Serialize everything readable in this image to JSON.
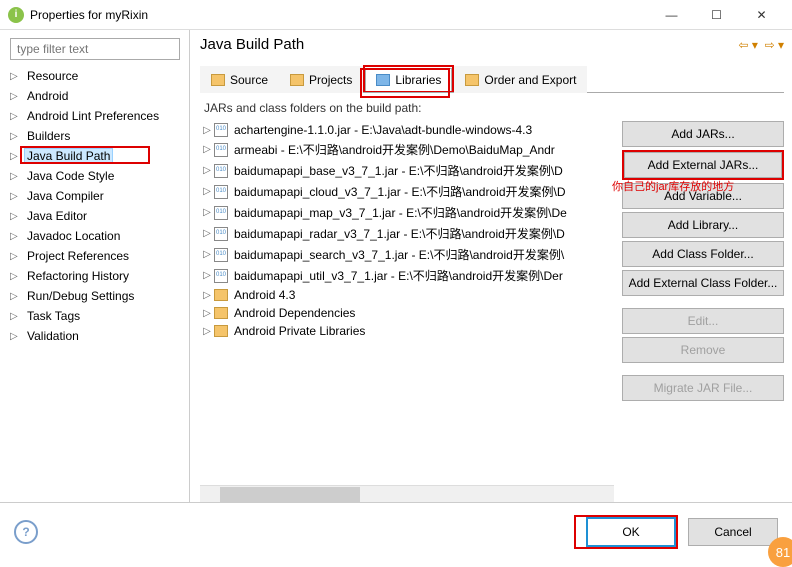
{
  "title": "Properties for myRixin",
  "filterPlaceholder": "type filter text",
  "tree": [
    "Resource",
    "Android",
    "Android Lint Preferences",
    "Builders",
    "Java Build Path",
    "Java Code Style",
    "Java Compiler",
    "Java Editor",
    "Javadoc Location",
    "Project References",
    "Refactoring History",
    "Run/Debug Settings",
    "Task Tags",
    "Validation"
  ],
  "treeSelectedIndex": 4,
  "heading": "Java Build Path",
  "tabs": [
    "Source",
    "Projects",
    "Libraries",
    "Order and Export"
  ],
  "activeTab": 2,
  "listHeader": "JARs and class folders on the build path:",
  "jars": [
    "achartengine-1.1.0.jar - E:\\Java\\adt-bundle-windows-4.3",
    "armeabi - E:\\不归路\\android开发案例\\Demo\\BaiduMap_Andr",
    "baidumapapi_base_v3_7_1.jar - E:\\不归路\\android开发案例\\D",
    "baidumapapi_cloud_v3_7_1.jar - E:\\不归路\\android开发案例\\D",
    "baidumapapi_map_v3_7_1.jar - E:\\不归路\\android开发案例\\De",
    "baidumapapi_radar_v3_7_1.jar - E:\\不归路\\android开发案例\\D",
    "baidumapapi_search_v3_7_1.jar - E:\\不归路\\android开发案例\\",
    "baidumapapi_util_v3_7_1.jar - E:\\不归路\\android开发案例\\Der"
  ],
  "libs": [
    "Android 4.3",
    "Android Dependencies",
    "Android Private Libraries"
  ],
  "buttons": {
    "addJars": "Add JARs...",
    "addExtJars": "Add External JARs...",
    "addVar": "Add Variable...",
    "addLib": "Add Library...",
    "addClassF": "Add Class Folder...",
    "addExtClassF": "Add External Class Folder...",
    "edit": "Edit...",
    "remove": "Remove",
    "migrate": "Migrate JAR File..."
  },
  "annotation": "你自己的jar库存放的地方",
  "ok": "OK",
  "cancel": "Cancel",
  "badge": "81"
}
